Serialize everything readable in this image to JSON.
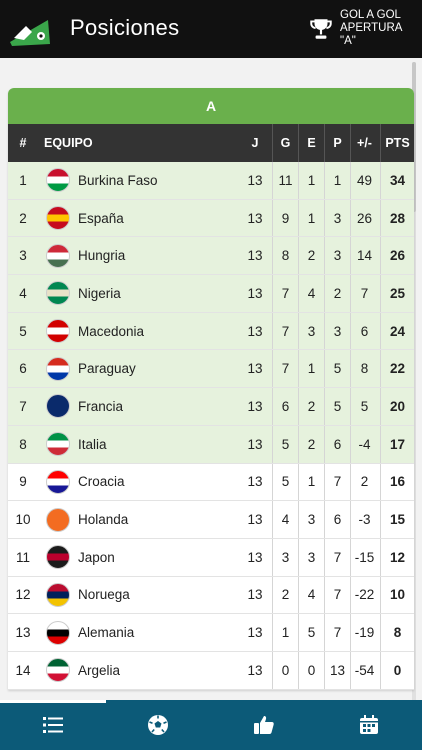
{
  "header": {
    "title": "Posiciones",
    "competition": [
      "GOL A GOL",
      "APERTURA",
      "\"A\""
    ]
  },
  "table": {
    "group": "A",
    "columns": {
      "pos": "#",
      "team": "EQUIPO",
      "j": "J",
      "g": "G",
      "e": "E",
      "p": "P",
      "diff": "+/-",
      "pts": "PTS"
    },
    "rows": [
      {
        "pos": "1",
        "team": "Burkina Faso",
        "j": "13",
        "g": "11",
        "e": "1",
        "p": "1",
        "diff": "49",
        "pts": "34",
        "flag": [
          "#c8102e",
          "#fff",
          "#009a44"
        ],
        "q": true
      },
      {
        "pos": "2",
        "team": "España",
        "j": "13",
        "g": "9",
        "e": "1",
        "p": "3",
        "diff": "26",
        "pts": "28",
        "flag": [
          "#c60b1e",
          "#ffc400",
          "#c60b1e"
        ],
        "q": true
      },
      {
        "pos": "3",
        "team": "Hungria",
        "j": "13",
        "g": "8",
        "e": "2",
        "p": "3",
        "diff": "14",
        "pts": "26",
        "flag": [
          "#ce2939",
          "#fff",
          "#477050"
        ],
        "q": true
      },
      {
        "pos": "4",
        "team": "Nigeria",
        "j": "13",
        "g": "7",
        "e": "4",
        "p": "2",
        "diff": "7",
        "pts": "25",
        "flag": [
          "#008751",
          "#e9e2c8",
          "#008751"
        ],
        "q": true
      },
      {
        "pos": "5",
        "team": "Macedonia",
        "j": "13",
        "g": "7",
        "e": "3",
        "p": "3",
        "diff": "6",
        "pts": "24",
        "flag": [
          "#d20000",
          "#fff",
          "#d20000"
        ],
        "q": true
      },
      {
        "pos": "6",
        "team": "Paraguay",
        "j": "13",
        "g": "7",
        "e": "1",
        "p": "5",
        "diff": "8",
        "pts": "22",
        "flag": [
          "#d52b1e",
          "#fff",
          "#0038a8"
        ],
        "q": true
      },
      {
        "pos": "7",
        "team": "Francia",
        "j": "13",
        "g": "6",
        "e": "2",
        "p": "5",
        "diff": "5",
        "pts": "20",
        "flag": [
          "#0a2a6b",
          "#0a2a6b",
          "#0a2a6b"
        ],
        "q": true
      },
      {
        "pos": "8",
        "team": "Italia",
        "j": "13",
        "g": "5",
        "e": "2",
        "p": "6",
        "diff": "-4",
        "pts": "17",
        "flag": [
          "#009246",
          "#fff",
          "#ce2b37"
        ],
        "q": true
      },
      {
        "pos": "9",
        "team": "Croacia",
        "j": "13",
        "g": "5",
        "e": "1",
        "p": "7",
        "diff": "2",
        "pts": "16",
        "flag": [
          "#ff0000",
          "#fff",
          "#171796"
        ],
        "q": false
      },
      {
        "pos": "10",
        "team": "Holanda",
        "j": "13",
        "g": "4",
        "e": "3",
        "p": "6",
        "diff": "-3",
        "pts": "15",
        "flag": [
          "#f36c21",
          "#f36c21",
          "#f36c21"
        ],
        "q": false
      },
      {
        "pos": "11",
        "team": "Japon",
        "j": "13",
        "g": "3",
        "e": "3",
        "p": "7",
        "diff": "-15",
        "pts": "12",
        "flag": [
          "#1b1b1b",
          "#bc002d",
          "#1b1b1b"
        ],
        "q": false
      },
      {
        "pos": "12",
        "team": "Noruega",
        "j": "13",
        "g": "2",
        "e": "4",
        "p": "7",
        "diff": "-22",
        "pts": "10",
        "flag": [
          "#ba0c2f",
          "#00205b",
          "#f3c300"
        ],
        "q": false
      },
      {
        "pos": "13",
        "team": "Alemania",
        "j": "13",
        "g": "1",
        "e": "5",
        "p": "7",
        "diff": "-19",
        "pts": "8",
        "flag": [
          "#fff",
          "#000",
          "#dd0000"
        ],
        "q": false
      },
      {
        "pos": "14",
        "team": "Argelia",
        "j": "13",
        "g": "0",
        "e": "0",
        "p": "13",
        "diff": "-54",
        "pts": "0",
        "flag": [
          "#006233",
          "#fff",
          "#d21034"
        ],
        "q": false
      }
    ]
  },
  "nav": [
    {
      "icon": "standings-list-icon",
      "active": true
    },
    {
      "icon": "soccer-ball-icon",
      "active": false
    },
    {
      "icon": "thumbs-up-icon",
      "active": false
    },
    {
      "icon": "calendar-icon",
      "active": false
    }
  ],
  "colors": {
    "header_bg": "#111111",
    "group_bar": "#6ab04c",
    "table_head": "#333333",
    "qualified_row": "#e6f2dd",
    "nav_bg": "#0c5a78"
  }
}
